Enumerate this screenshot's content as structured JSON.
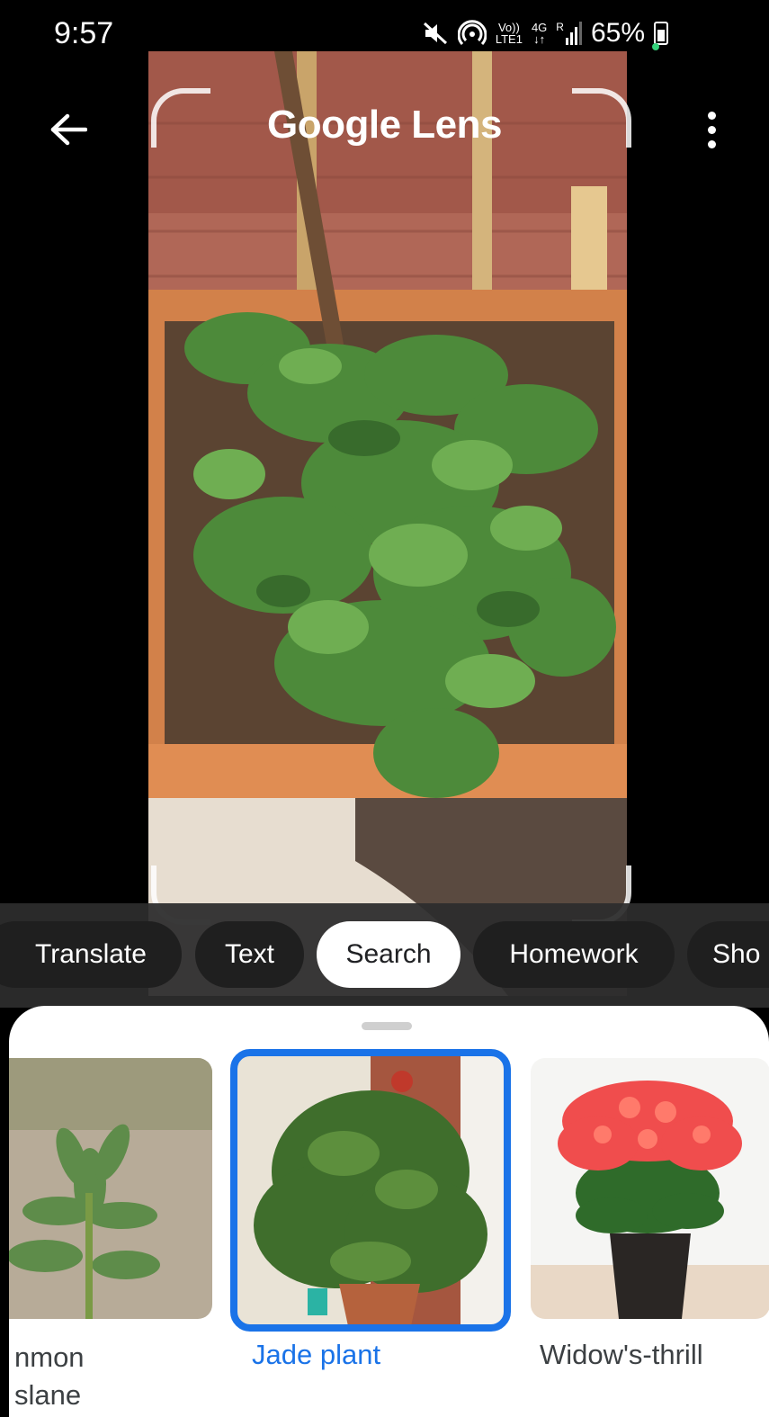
{
  "status_bar": {
    "time": "9:57",
    "network_top": "Vo))",
    "network_bottom": "LTE1",
    "gen_top": "4G",
    "gen_bottom": "↓↑",
    "roaming": "R",
    "battery": "65%"
  },
  "header": {
    "back_icon": "arrow-back-icon",
    "title": "Google Lens",
    "menu_icon": "more-vert-icon"
  },
  "modes": [
    {
      "label": "Translate"
    },
    {
      "label": "Text"
    },
    {
      "label": "Search",
      "active": true
    },
    {
      "label": "Homework"
    },
    {
      "label": "Sho"
    }
  ],
  "results": [
    {
      "line1": "nmon",
      "line2": "slane",
      "selected": false
    },
    {
      "line1": "Jade plant",
      "selected": true
    },
    {
      "line1": "Widow's-thrill",
      "selected": false
    }
  ],
  "colors": {
    "accent": "#1a73e8",
    "chip_bg": "#1f1f1f",
    "sheet_bg": "#ffffff"
  }
}
